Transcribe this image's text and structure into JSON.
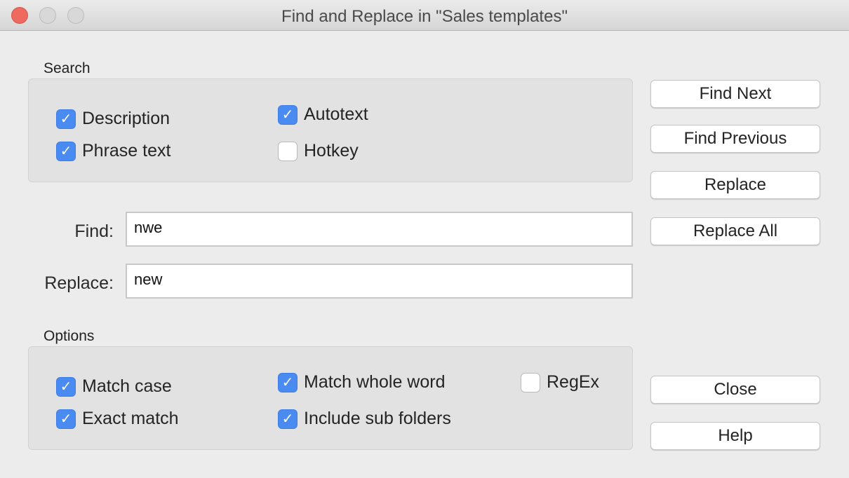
{
  "window": {
    "title": "Find and Replace in \"Sales templates\""
  },
  "search": {
    "label": "Search",
    "options": [
      {
        "label": "Description",
        "checked": true
      },
      {
        "label": "Phrase text",
        "checked": true
      },
      {
        "label": "Autotext",
        "checked": true
      },
      {
        "label": "Hotkey",
        "checked": false
      }
    ]
  },
  "find": {
    "label": "Find:",
    "value": "nwe"
  },
  "replace": {
    "label": "Replace:",
    "value": "new"
  },
  "options": {
    "label": "Options",
    "items": [
      {
        "label": "Match case",
        "checked": true
      },
      {
        "label": "Exact match",
        "checked": true
      },
      {
        "label": "Match whole word",
        "checked": true
      },
      {
        "label": "Include sub folders",
        "checked": true
      },
      {
        "label": "RegEx",
        "checked": false
      }
    ]
  },
  "buttons": {
    "find_next": "Find Next",
    "find_previous": "Find Previous",
    "replace": "Replace",
    "replace_all": "Replace All",
    "close": "Close",
    "help": "Help"
  },
  "icons": {
    "check": "✓"
  }
}
